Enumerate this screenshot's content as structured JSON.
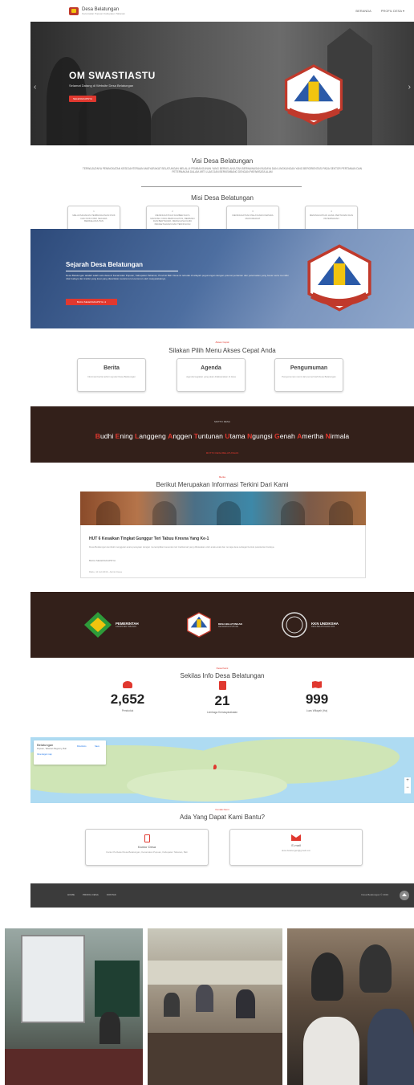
{
  "nav": {
    "brand": "Desa Belatungan",
    "brand_sub": "Kecamatan Pupuan Kabupaten Tabanan",
    "links": [
      "BERANDA",
      "PROFIL DESA"
    ]
  },
  "hero": {
    "title": "OM SWASTIASTU",
    "tagline": "Selamat Datang di Website Desa Belatungan",
    "button": "SELENGKAPNYA"
  },
  "visi": {
    "title": "Visi Desa Belatungan",
    "text": "TERWUJUDNYA PENINGKATAN KESEJAHTERAAN MASYARAKAT BELATUNGAN MELALUI PEMBANGUNAN YANG BERKELANJUTAN BERWAWASAN BUDAYA DAN LINGKUNGAN YANG BERORIENTASI PADA SEKTOR PERTANIAN DAN PETERNAKAN DALAM ARTI LUAS DAN BERKEMBANG DENGAN PARIWISATA ALAM"
  },
  "misi": {
    "title": "Misi Desa Belatungan",
    "items": [
      {
        "num": "1",
        "text": "MELAKSANAKAN PEMBANGUNAN FISIK DAN NON FISIK SECARA BERKELANJUTAN"
      },
      {
        "num": "2",
        "text": "MENINGKATKAN SUMBER DAYA MANUSIA YANG BERKUALITAS, BERIMAN DAN BERTAQWA, MENGUASAI ILMU PENGETAHUAN DAN TEKNOLOGI"
      },
      {
        "num": "3",
        "text": "MENINGKATKAN PELAYANAN KEPADA MASYARAKAT"
      },
      {
        "num": "4",
        "text": "MENINGKATKAN HASIL PERTANIAN DAN PETERNAKAN"
      }
    ]
  },
  "sejarah": {
    "title": "Sejarah Desa Belatungan",
    "text": "Desa Belatungan adalah salah satu desa di Kecamatan Pupuan, Kabupaten Tabanan, Provinsi Bali. Desa ini terletak di wilayah pegunungan dengan potensi pertanian dan peternakan yang besar serta memiliki nilai budaya dan tradisi yang kuat yang diwariskan secara turun-temurun oleh masyarakatnya.",
    "button": "BACA SELENGKAPNYA"
  },
  "menu": {
    "kicker": "Akses Cepat",
    "title": "Silakan Pilih Menu Akses Cepat Anda",
    "items": [
      {
        "title": "Berita",
        "desc": "Informasi berita terkini seputar Desa Belatungan"
      },
      {
        "title": "Agenda",
        "desc": "Agenda kegiatan yang akan dilaksanakan di desa"
      },
      {
        "title": "Pengumuman",
        "desc": "Pengumuman resmi dari pemerintah Desa Belatungan"
      }
    ]
  },
  "motto": {
    "label": "MOTTO DESA",
    "words": [
      {
        "initial": "B",
        "rest": "udhi "
      },
      {
        "initial": "E",
        "rest": "ning "
      },
      {
        "initial": "L",
        "rest": "anggeng "
      },
      {
        "initial": "A",
        "rest": "nggen "
      },
      {
        "initial": "T",
        "rest": "untunan "
      },
      {
        "initial": "U",
        "rest": "tama "
      },
      {
        "initial": "N",
        "rest": "gungsi "
      },
      {
        "initial": "G",
        "rest": "enah "
      },
      {
        "initial": "A",
        "rest": "mertha "
      },
      {
        "initial": "N",
        "rest": "irmala"
      }
    ],
    "by": "MOTTO DESA BELATUNGAN"
  },
  "berita": {
    "kicker": "Berita",
    "title": "Berikut Merupakan Informasi Terkini Dari Kami",
    "headline": "HUT 6 Kesaikan Tingkat Gunggur Teri Tabuu Kresna Yang Ke-1",
    "excerpt": "Desa Belatungan kembali menggelar acara perayaan dengan menampilkan kesenian tari tradisional yang dibawakan oleh anak-anak dan remaja desa sebagai bentuk pelestarian budaya.",
    "more": "BACA SELENGKAPNYA",
    "date": "Rabu, 10 Juli 2019 - Admin Desa"
  },
  "partners": [
    {
      "name": "PEMERINTAH",
      "sub": "KABUPATEN TABANAN"
    },
    {
      "name": "DESA BELATUNGAN",
      "sub": "KECAMATAN PUPUAN"
    },
    {
      "name": "KKN UNDIKSHA",
      "sub": "DESA BELATUNGAN 2019"
    }
  ],
  "sekilas": {
    "kicker": "Desa Kami",
    "title": "Sekilas Info Desa Belatungan",
    "stats": [
      {
        "value": "2,652",
        "label": "Penduduk"
      },
      {
        "value": "21",
        "label": "Lembaga Kemasyarakatan"
      },
      {
        "value": "999",
        "label": "Luas Wilayah (Ha)"
      }
    ]
  },
  "map": {
    "place": "Belatungan",
    "sub": "Pupuan, Tabanan Regency, Bali",
    "link": "View larger map",
    "directions": "Directions",
    "save": "Save",
    "zoom_in": "+",
    "zoom_out": "−"
  },
  "bantu": {
    "kicker": "Kontak Kami",
    "title": "Ada Yang Dapat Kami Bantu?",
    "items": [
      {
        "title": "Kantor Desa",
        "desc": "Kantor Perbekel Desa Belatungan, Kecamatan Pupuan, Kabupaten Tabanan, Bali"
      },
      {
        "title": "E-mail",
        "desc": "desa.belatungan@gmail.com"
      }
    ]
  },
  "footer": {
    "links": [
      "HOME",
      "PROFIL DESA",
      "KONTAK"
    ],
    "copy": "Desa Belatungan © 2019"
  },
  "colors": {
    "accent": "#e0382f",
    "dark": "#33201a",
    "footer": "#3b3b3b"
  }
}
